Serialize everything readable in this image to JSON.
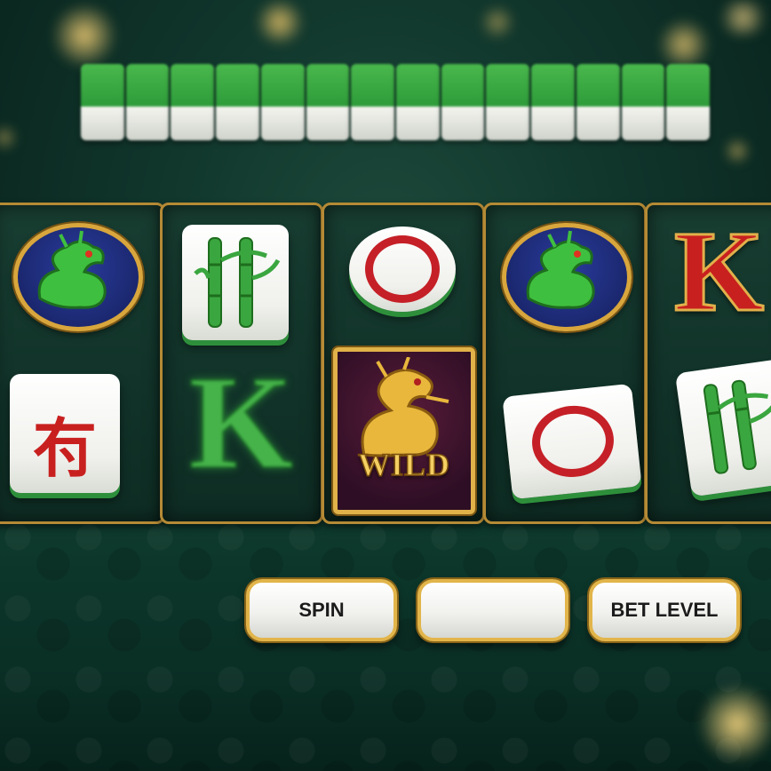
{
  "buttons": {
    "spin_label": "SPIN",
    "middle_label": "",
    "bet_level_label": "BET LEVEL"
  },
  "reels": [
    {
      "symbols": [
        "dragon-badge",
        "red-kanji-tile"
      ]
    },
    {
      "symbols": [
        "bamboo-tile",
        "green-k"
      ]
    },
    {
      "symbols": [
        "red-circle-tile",
        "wild-dragon"
      ]
    },
    {
      "symbols": [
        "dragon-badge",
        "red-circle-tile"
      ]
    },
    {
      "symbols": [
        "red-k",
        "bamboo-tile"
      ]
    }
  ],
  "symbol_text": {
    "kanji": "𠕇",
    "k_letter": "K",
    "wild": "WILD"
  },
  "colors": {
    "felt": "#10352b",
    "gold": "#e2b54a",
    "tile_green": "#2e8f3b",
    "tile_red": "#c52027"
  }
}
